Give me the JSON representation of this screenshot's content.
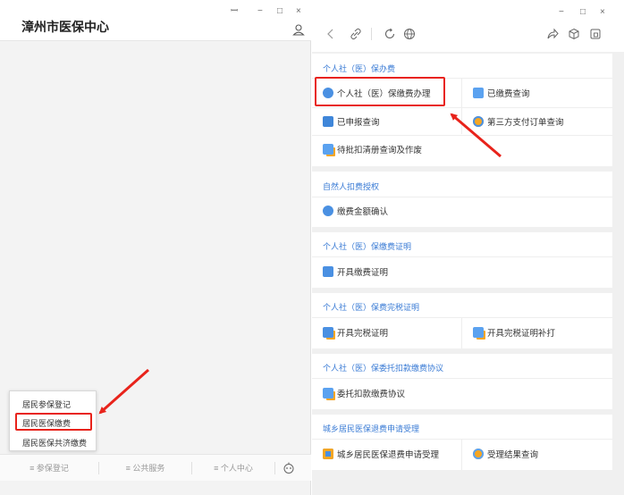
{
  "left": {
    "title": "漳州市医保中心",
    "window_controls": [
      "ꟷ",
      "−",
      "□",
      "×"
    ],
    "popup_items": [
      "居民参保登记",
      "居民医保缴费",
      "居民医保共济缴费"
    ],
    "tabs": [
      "≡ 参保登记",
      "≡ 公共服务",
      "≡ 个人中心"
    ]
  },
  "right": {
    "window_controls": [
      "−",
      "□",
      "×"
    ],
    "sections": [
      {
        "title": "个人社（医）保办费",
        "items": [
          "个人社（医）保缴费办理",
          "已缴费查询",
          "已申报查询",
          "第三方支付订单查询",
          "待批扣清册查询及作废"
        ]
      },
      {
        "title": "自然人扣费授权",
        "items": [
          "缴费金额确认"
        ]
      },
      {
        "title": "个人社（医）保缴费证明",
        "items": [
          "开具缴费证明"
        ]
      },
      {
        "title": "个人社（医）保费完税证明",
        "items": [
          "开具完税证明",
          "开具完税证明补打"
        ]
      },
      {
        "title": "个人社（医）保委托扣款缴费协议",
        "items": [
          "委托扣款缴费协议"
        ]
      },
      {
        "title": "城乡居民医保退费申请受理",
        "items": [
          "城乡居民医保退费申请受理",
          "受理结果查询"
        ]
      }
    ]
  },
  "colors": {
    "accent": "#3a7bd5",
    "highlight": "#e8231b"
  }
}
